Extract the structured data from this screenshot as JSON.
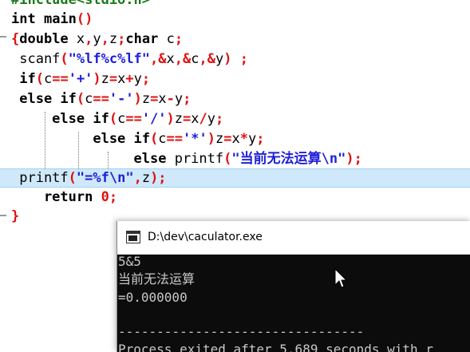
{
  "editor": {
    "lines": [
      {
        "id": "include",
        "parts": [
          {
            "t": "#include<stdio.h>",
            "c": "pp"
          }
        ]
      },
      {
        "id": "main",
        "parts": [
          {
            "t": "int",
            "c": "kw"
          },
          {
            "t": " main",
            "c": "kw"
          },
          {
            "t": "()",
            "c": "op"
          }
        ]
      },
      {
        "id": "decl",
        "parts": [
          {
            "t": "{",
            "c": "op"
          },
          {
            "t": "double",
            "c": "kw"
          },
          {
            "t": " x",
            "c": "id"
          },
          {
            "t": ",",
            "c": "op"
          },
          {
            "t": "y",
            "c": "id"
          },
          {
            "t": ",",
            "c": "op"
          },
          {
            "t": "z",
            "c": "id"
          },
          {
            "t": ";",
            "c": "op"
          },
          {
            "t": "char",
            "c": "kw"
          },
          {
            "t": " c",
            "c": "id"
          },
          {
            "t": ";",
            "c": "op"
          }
        ]
      },
      {
        "id": "scanf",
        "parts": [
          {
            "t": " scanf",
            "c": "id"
          },
          {
            "t": "(",
            "c": "op"
          },
          {
            "t": "\"%lf%c%lf\"",
            "c": "str"
          },
          {
            "t": ",&",
            "c": "op"
          },
          {
            "t": "x",
            "c": "id"
          },
          {
            "t": ",&",
            "c": "op"
          },
          {
            "t": "c",
            "c": "id"
          },
          {
            "t": ",&",
            "c": "op"
          },
          {
            "t": "y",
            "c": "id"
          },
          {
            "t": ") ;",
            "c": "op"
          }
        ]
      },
      {
        "id": "if-add",
        "parts": [
          {
            "t": " if",
            "c": "kw"
          },
          {
            "t": "(",
            "c": "op"
          },
          {
            "t": "c",
            "c": "id"
          },
          {
            "t": "==",
            "c": "op"
          },
          {
            "t": "'+'",
            "c": "str"
          },
          {
            "t": ")",
            "c": "op"
          },
          {
            "t": "z",
            "c": "id"
          },
          {
            "t": "=",
            "c": "op"
          },
          {
            "t": "x",
            "c": "id"
          },
          {
            "t": "+",
            "c": "op"
          },
          {
            "t": "y",
            "c": "id"
          },
          {
            "t": ";",
            "c": "op"
          }
        ]
      },
      {
        "id": "if-sub",
        "parts": [
          {
            "t": " else if",
            "c": "kw"
          },
          {
            "t": "(",
            "c": "op"
          },
          {
            "t": "c",
            "c": "id"
          },
          {
            "t": "==",
            "c": "op"
          },
          {
            "t": "'-'",
            "c": "str"
          },
          {
            "t": ")",
            "c": "op"
          },
          {
            "t": "z",
            "c": "id"
          },
          {
            "t": "=",
            "c": "op"
          },
          {
            "t": "x",
            "c": "id"
          },
          {
            "t": "-",
            "c": "op"
          },
          {
            "t": "y",
            "c": "id"
          },
          {
            "t": ";",
            "c": "op"
          }
        ]
      },
      {
        "id": "if-div",
        "parts": [
          {
            "t": "     else if",
            "c": "kw"
          },
          {
            "t": "(",
            "c": "op"
          },
          {
            "t": "c",
            "c": "id"
          },
          {
            "t": "==",
            "c": "op"
          },
          {
            "t": "'/'",
            "c": "str"
          },
          {
            "t": ")",
            "c": "op"
          },
          {
            "t": "z",
            "c": "id"
          },
          {
            "t": "=",
            "c": "op"
          },
          {
            "t": "x",
            "c": "id"
          },
          {
            "t": "/",
            "c": "op"
          },
          {
            "t": "y",
            "c": "id"
          },
          {
            "t": ";",
            "c": "op"
          }
        ]
      },
      {
        "id": "if-mul",
        "parts": [
          {
            "t": "          else if",
            "c": "kw"
          },
          {
            "t": "(",
            "c": "op"
          },
          {
            "t": "c",
            "c": "id"
          },
          {
            "t": "==",
            "c": "op"
          },
          {
            "t": "'*'",
            "c": "str"
          },
          {
            "t": ")",
            "c": "op"
          },
          {
            "t": "z",
            "c": "id"
          },
          {
            "t": "=",
            "c": "op"
          },
          {
            "t": "x",
            "c": "id"
          },
          {
            "t": "*",
            "c": "op"
          },
          {
            "t": "y",
            "c": "id"
          },
          {
            "t": ";",
            "c": "op"
          }
        ]
      },
      {
        "id": "else-printf",
        "parts": [
          {
            "t": "               else ",
            "c": "kw"
          },
          {
            "t": "printf",
            "c": "id"
          },
          {
            "t": "(",
            "c": "op"
          },
          {
            "t": "\"当前无法运算\\n\"",
            "c": "str"
          },
          {
            "t": ");",
            "c": "op"
          }
        ]
      },
      {
        "id": "printf",
        "parts": [
          {
            "t": " printf",
            "c": "id"
          },
          {
            "t": "(",
            "c": "op"
          },
          {
            "t": "\"=%f\\n\"",
            "c": "str"
          },
          {
            "t": ",",
            "c": "op"
          },
          {
            "t": "z",
            "c": "id"
          },
          {
            "t": ");",
            "c": "op"
          }
        ]
      },
      {
        "id": "return",
        "parts": [
          {
            "t": "    return ",
            "c": "kw"
          },
          {
            "t": "0",
            "c": "num"
          },
          {
            "t": ";",
            "c": "op"
          }
        ]
      },
      {
        "id": "close",
        "parts": [
          {
            "t": "}",
            "c": "op"
          }
        ]
      }
    ]
  },
  "console": {
    "title": "D:\\dev\\caculator.exe",
    "lines": [
      "5&5",
      "当前无法运算",
      "=0.000000",
      "",
      "--------------------------------",
      "Process exited after 5.689 seconds with r"
    ]
  }
}
